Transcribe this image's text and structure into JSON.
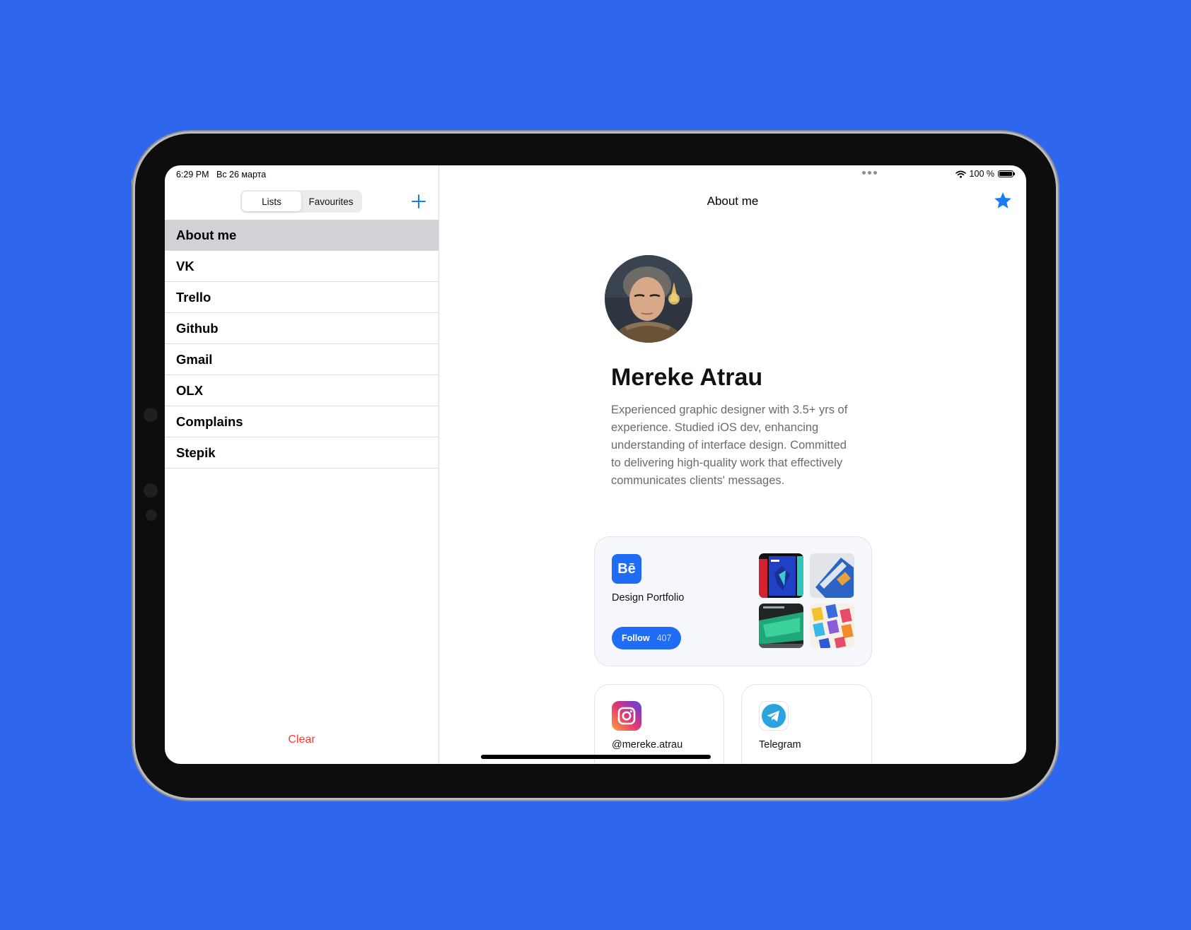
{
  "status_bar": {
    "time": "6:29 PM",
    "date": "Вс 26 марта",
    "battery": "100 %",
    "battery_level": 1.0
  },
  "sidebar": {
    "segments": [
      {
        "label": "Lists",
        "active": true
      },
      {
        "label": "Favourites",
        "active": false
      }
    ],
    "add_icon": "plus-icon",
    "items": [
      {
        "label": "About me",
        "selected": true
      },
      {
        "label": "VK"
      },
      {
        "label": "Trello"
      },
      {
        "label": "Github"
      },
      {
        "label": "Gmail"
      },
      {
        "label": "OLX"
      },
      {
        "label": "Complains"
      },
      {
        "label": "Stepik"
      }
    ],
    "clear_label": "Clear"
  },
  "main": {
    "title": "About me",
    "favorite_icon": "star-icon",
    "profile": {
      "name": "Mereke Atrau",
      "bio": "Experienced graphic designer with 3.5+ yrs of experience. Studied iOS dev, enhancing understanding of interface design. Committed to delivering high-quality work that effectively communicates clients' messages."
    },
    "behance": {
      "logo_text": "Bē",
      "label": "Design Portfolio",
      "follow_label": "Follow",
      "follow_count": "407"
    },
    "instagram": {
      "label": "@mereke.atrau"
    },
    "telegram": {
      "label": "Telegram"
    }
  },
  "colors": {
    "background": "#2f66ee",
    "accent": "#1f6cf5",
    "destructive": "#ff3b30",
    "selected_row": "#d1d1d6"
  }
}
